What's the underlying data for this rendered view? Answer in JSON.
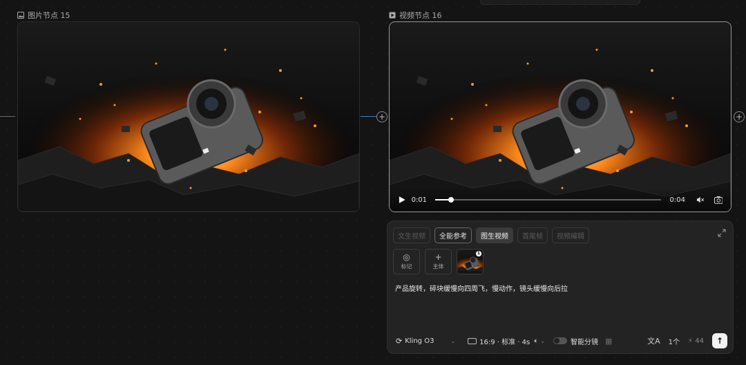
{
  "image_node": {
    "title": "图片节点 15",
    "icon": "image-icon"
  },
  "video_node": {
    "title": "视频节点 16",
    "icon": "video-icon",
    "current_time": "0:01",
    "duration": "0:04",
    "progress": 0.07
  },
  "panel": {
    "tabs": [
      {
        "label": "文生视频",
        "state": "disabled"
      },
      {
        "label": "全能参考",
        "state": "enabled"
      },
      {
        "label": "图生视频",
        "state": "active"
      },
      {
        "label": "首尾帧",
        "state": "disabled"
      },
      {
        "label": "视频编辑",
        "state": "disabled"
      }
    ],
    "tools": {
      "mark_label": "标记",
      "subject_label": "主体",
      "thumb_badge": "1"
    },
    "prompt": "产品旋转，碎块缓慢向四周飞，慢动作，镜头缓慢向后拉",
    "model": "Kling O3",
    "settings": "16:9 · 标准 · 4s",
    "smart_storyboard": "智能分镜",
    "count": "1个",
    "credits": "44"
  },
  "colors": {
    "accent": "#ff8a1c",
    "panel_bg": "#232323",
    "canvas_bg": "#141414"
  }
}
